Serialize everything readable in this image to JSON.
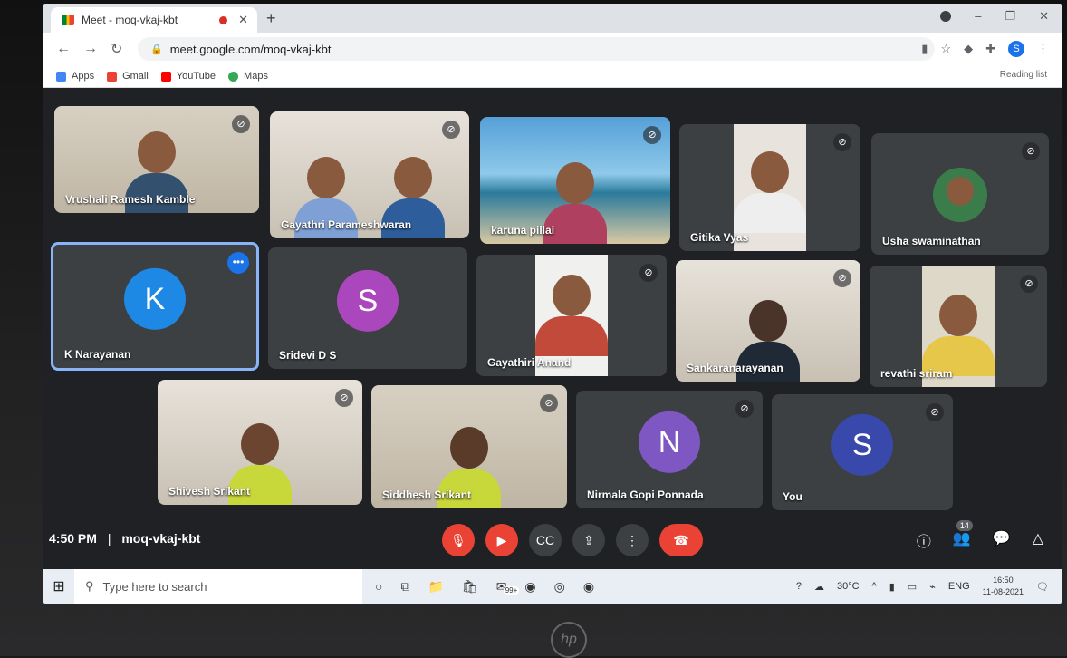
{
  "browser": {
    "tab_title": "Meet - moq-vkaj-kbt",
    "new_tab": "+",
    "url": "meet.google.com/moq-vkaj-kbt",
    "profile_initial": "S",
    "bookmarks": [
      {
        "label": "Apps",
        "color": "#4285f4"
      },
      {
        "label": "Gmail",
        "color": "#ea4335"
      },
      {
        "label": "YouTube",
        "color": "#ff0000"
      },
      {
        "label": "Maps",
        "color": "#34a853"
      }
    ],
    "reading_list": "Reading list"
  },
  "participants": [
    {
      "name": "Vrushali Ramesh Kamble",
      "type": "video"
    },
    {
      "name": "Gayathri Parameshwaran",
      "type": "video"
    },
    {
      "name": "karuna pillai",
      "type": "video"
    },
    {
      "name": "Gitika Vyas",
      "type": "video"
    },
    {
      "name": "Usha swaminathan",
      "type": "video"
    },
    {
      "name": "K Narayanan",
      "type": "avatar",
      "initial": "K",
      "color": "#1e88e5"
    },
    {
      "name": "Sridevi D S",
      "type": "avatar",
      "initial": "S",
      "color": "#ab47bc"
    },
    {
      "name": "Gayathiri Anand",
      "type": "video"
    },
    {
      "name": "Sankaranarayanan",
      "type": "video"
    },
    {
      "name": "revathi sriram",
      "type": "video"
    },
    {
      "name": "Shivesh Srikant",
      "type": "video"
    },
    {
      "name": "Siddhesh Srikant",
      "type": "video"
    },
    {
      "name": "Nirmala Gopi Ponnada",
      "type": "avatar",
      "initial": "N",
      "color": "#7e57c2"
    },
    {
      "name": "You",
      "type": "avatar",
      "initial": "S",
      "color": "#3949ab"
    }
  ],
  "meeting": {
    "time": "4:50 PM",
    "separator": "|",
    "code": "moq-vkaj-kbt",
    "participant_count": "14"
  },
  "taskbar": {
    "search_placeholder": "Type here to search",
    "mail_badge": "99+",
    "temperature": "30°C",
    "language": "ENG",
    "time": "16:50",
    "date": "11-08-2021"
  },
  "device_logo": "hp"
}
